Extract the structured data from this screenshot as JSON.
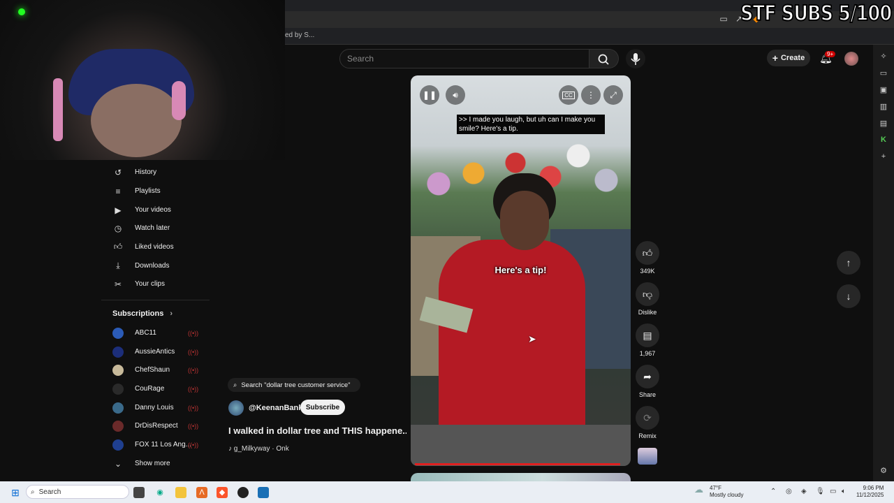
{
  "overlay": {
    "sub_goal": "STF SUBS 5/100"
  },
  "browser": {
    "address_fragment": "ed by S..."
  },
  "header": {
    "search_placeholder": "Search",
    "create_label": "Create",
    "notification_count": "9+"
  },
  "sidebar": {
    "items": [
      {
        "label": "History",
        "icon": "history-icon"
      },
      {
        "label": "Playlists",
        "icon": "playlists-icon"
      },
      {
        "label": "Your videos",
        "icon": "your-videos-icon"
      },
      {
        "label": "Watch later",
        "icon": "watch-later-icon"
      },
      {
        "label": "Liked videos",
        "icon": "thumbs-up-icon"
      },
      {
        "label": "Downloads",
        "icon": "download-icon"
      },
      {
        "label": "Your clips",
        "icon": "scissors-icon"
      }
    ],
    "subscriptions_title": "Subscriptions",
    "subscriptions": [
      {
        "name": "ABC11",
        "color": "#2b5bb7"
      },
      {
        "name": "AussieAntics",
        "color": "#1c2e7a"
      },
      {
        "name": "ChefShaun",
        "color": "#c7b99a"
      },
      {
        "name": "CouRage",
        "color": "#2a2a2a"
      },
      {
        "name": "Danny Louis",
        "color": "#3a6a8a"
      },
      {
        "name": "DrDisRespect",
        "color": "#6a2a2a"
      },
      {
        "name": "FOX 11 Los Ang...",
        "color": "#1f3f8f"
      }
    ],
    "show_more": "Show more"
  },
  "short": {
    "search_suggestion": "Search \"dollar tree customer service\"",
    "channel": "@KeenanBank",
    "subscribe_label": "Subscribe",
    "title": "I walked in dollar tree and THIS happene...",
    "music": "g_Milkyway · Onk",
    "caption": ">> I made you laugh, but uh can I make you smile? Here's a tip.",
    "overlay_text": "Here's a tip!",
    "progress_fraction": 0.97
  },
  "actions": {
    "likes": "349K",
    "dislike": "Dislike",
    "comments": "1,967",
    "share": "Share",
    "remix": "Remix"
  },
  "taskbar": {
    "search_label": "Search",
    "weather_temp": "47°F",
    "weather_desc": "Mostly cloudy",
    "time": "9:06 PM",
    "date": "11/12/2025"
  },
  "colors": {
    "accent_red": "#cc0000",
    "caption_bg": "#080808"
  }
}
